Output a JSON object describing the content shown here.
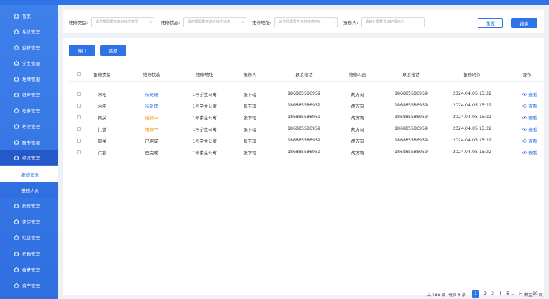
{
  "sidebar": {
    "items": [
      {
        "label": "首页"
      },
      {
        "label": "系统管理"
      },
      {
        "label": "迎新管理"
      },
      {
        "label": "学生管理"
      },
      {
        "label": "教师管理"
      },
      {
        "label": "宿舍管理"
      },
      {
        "label": "教学管理"
      },
      {
        "label": "考试管理"
      },
      {
        "label": "图书管理"
      },
      {
        "label": "报修管理"
      },
      {
        "label": "报修记录"
      },
      {
        "label": "维修人员"
      },
      {
        "label": "教程管理"
      },
      {
        "label": "实习管理"
      },
      {
        "label": "就业管理"
      },
      {
        "label": "考勤管理"
      },
      {
        "label": "缴费管理"
      },
      {
        "label": "资产管理"
      }
    ]
  },
  "filter": {
    "type_label": "维修类型:",
    "type_placeholder": "请选择需要查询的维修类型",
    "status_label": "维修状态:",
    "status_placeholder": "请选择需要查询的维修状态",
    "address_label": "维修地址:",
    "address_placeholder": "请选择需要查询的维修地址",
    "reporter_label": "报修人:",
    "reporter_placeholder": "请输入需要查询的报修人",
    "reset_label": "重置",
    "search_label": "搜索"
  },
  "toolbar": {
    "export_label": "导出",
    "add_label": "新增"
  },
  "table": {
    "headers": [
      "报修类型",
      "维修状态",
      "维修地址",
      "报修人",
      "联系电话",
      "维修人员",
      "联系电话",
      "报修时间",
      "操作"
    ],
    "rows": [
      {
        "type": "水电",
        "status": "待处理",
        "status_color": "#2f74e6",
        "address": "1号学生公寓",
        "reporter": "张下辖",
        "phone": "186885586959",
        "worker": "胡方向",
        "worker_phone": "186885586959",
        "time": "2024.04.05 15:22",
        "action": "查看"
      },
      {
        "type": "水电",
        "status": "待处理",
        "status_color": "#2f74e6",
        "address": "1号学生公寓",
        "reporter": "张下辖",
        "phone": "186885586959",
        "worker": "胡方向",
        "worker_phone": "186885586959",
        "time": "2024.04.05 15:22",
        "action": "查看"
      },
      {
        "type": "网关",
        "status": "维修中",
        "status_color": "#f08c00",
        "address": "1号学生公寓",
        "reporter": "张下辖",
        "phone": "186885586959",
        "worker": "胡方向",
        "worker_phone": "186885586959",
        "time": "2024.04.05 15:22",
        "action": "查看"
      },
      {
        "type": "门锁",
        "status": "维修中",
        "status_color": "#f08c00",
        "address": "1号学生公寓",
        "reporter": "张下辖",
        "phone": "186885586959",
        "worker": "胡方向",
        "worker_phone": "186885586959",
        "time": "2024.04.05 15:22",
        "action": "查看"
      },
      {
        "type": "网关",
        "status": "已完成",
        "status_color": "#333333",
        "address": "1号学生公寓",
        "reporter": "张下辖",
        "phone": "186885586959",
        "worker": "胡方向",
        "worker_phone": "186885586959",
        "time": "2024.04.05 15:22",
        "action": "查看"
      },
      {
        "type": "门锁",
        "status": "已完成",
        "status_color": "#333333",
        "address": "1号学生公寓",
        "reporter": "张下辖",
        "phone": "186885586959",
        "worker": "胡方向",
        "worker_phone": "186885586959",
        "time": "2024.04.05 15:22",
        "action": "查看"
      }
    ]
  },
  "pagination": {
    "total_text": "共 160 条",
    "page_size_text": "每页 8 条",
    "pages": [
      "1",
      "2",
      "3",
      "4",
      "5"
    ],
    "ellipsis": "...",
    "next": ">",
    "goto_text": "转至",
    "goto_value": "10",
    "page_unit": "页"
  },
  "colors": {
    "accent": "#2f74e6",
    "warning": "#f08c00"
  }
}
